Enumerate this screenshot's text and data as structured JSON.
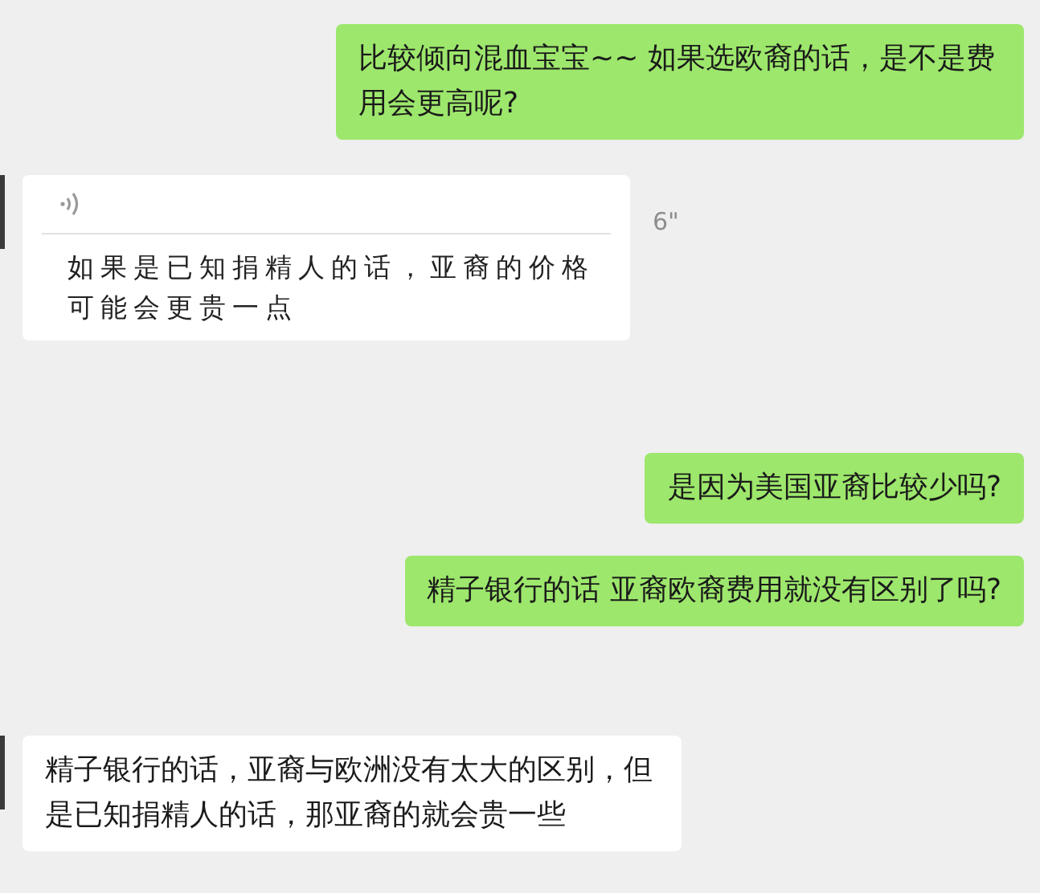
{
  "messages": [
    {
      "kind": "text",
      "outgoing": true,
      "text": "比较倾向混血宝宝~~ 如果选欧裔的话，是不是费用会更高呢?"
    },
    {
      "kind": "voice",
      "outgoing": false,
      "duration": "6\"",
      "text": "如果是已知捐精人的话，亚裔的价格可能会更贵一点"
    },
    {
      "kind": "text",
      "outgoing": true,
      "text": "是因为美国亚裔比较少吗?"
    },
    {
      "kind": "text",
      "outgoing": true,
      "text": "精子银行的话  亚裔欧裔费用就没有区别了吗?"
    },
    {
      "kind": "text",
      "outgoing": false,
      "text": "精子银行的话，亚裔与欧洲没有太大的区别，但是已知捐精人的话，那亚裔的就会贵一些"
    }
  ]
}
